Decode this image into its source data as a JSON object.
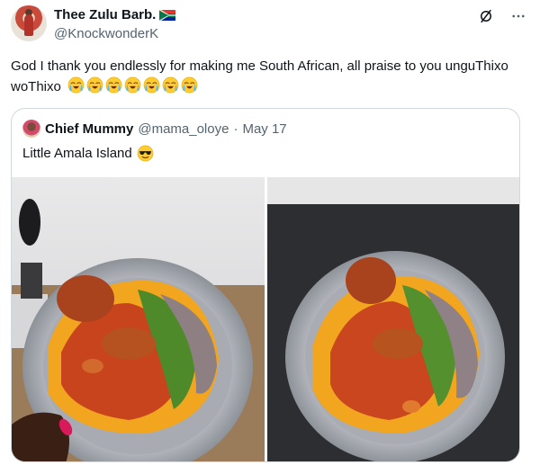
{
  "tweet": {
    "display_name": "Thee Zulu Barb.",
    "flag_icon": "south-africa-flag-icon",
    "handle": "@KnockwonderK",
    "text": "God I thank you endlessly for making me South African, all praise to you unguThixo woThixo",
    "emoji_icon": "loudly-crying-face-icon",
    "emoji_count": 7
  },
  "top_icons": [
    "grok-icon",
    "more-icon"
  ],
  "quote": {
    "display_name": "Chief Mummy",
    "handle": "@mama_oloye",
    "separator": "·",
    "date": "May 17",
    "text": "Little Amala Island",
    "emoji_icon": "sunglasses-face-icon",
    "photos": [
      "amala-plate-photo-1",
      "amala-plate-photo-2"
    ]
  },
  "colors": {
    "text": "#0f1419",
    "secondary": "#536471",
    "border": "#cfd9de"
  }
}
